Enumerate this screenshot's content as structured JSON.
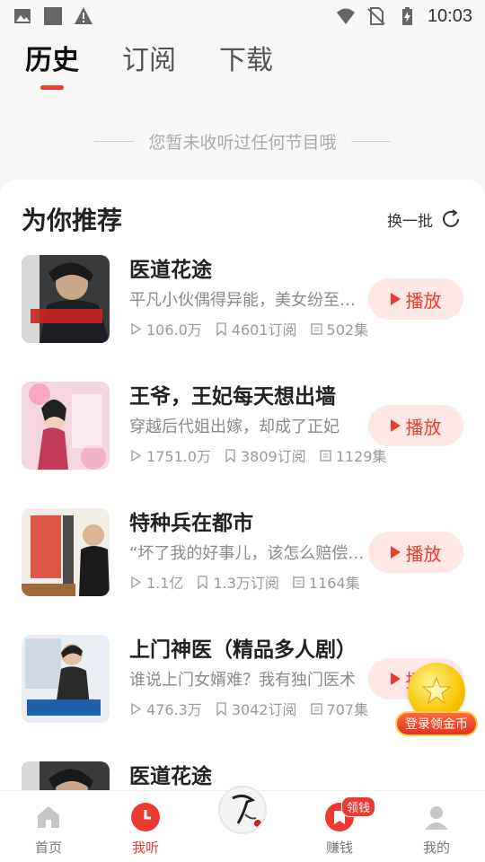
{
  "status_bar": {
    "time": "10:03",
    "icons_left": [
      "image-icon",
      "square-icon",
      "warning-icon"
    ],
    "icons_right": [
      "wifi-icon",
      "no-sim-icon",
      "battery-charging-icon"
    ]
  },
  "tabs": [
    {
      "label": "历史",
      "active": true
    },
    {
      "label": "订阅",
      "active": false
    },
    {
      "label": "下载",
      "active": false
    }
  ],
  "empty_text": "您暂未收听过任何节目哦",
  "recommend": {
    "title": "为你推荐",
    "refresh_label": "换一批",
    "play_label": "播放",
    "items": [
      {
        "title": "医道花途",
        "desc": "平凡小伙偶得异能，美女纷至沓来",
        "plays": "106.0万",
        "subs": "4601订阅",
        "eps": "502集"
      },
      {
        "title": "王爷，王妃每天想出墙",
        "desc": "穿越后代姐出嫁，却成了正妃",
        "plays": "1751.0万",
        "subs": "3809订阅",
        "eps": "1129集"
      },
      {
        "title": "特种兵在都市",
        "desc": "“坏了我的好事儿，该怎么赔偿我？”",
        "plays": "1.1亿",
        "subs": "1.3万订阅",
        "eps": "1164集"
      },
      {
        "title": "上门神医（精品多人剧）",
        "desc": "谁说上门女婿难？我有独门医术",
        "plays": "476.3万",
        "subs": "3042订阅",
        "eps": "707集"
      },
      {
        "title": "医道花途",
        "desc": "",
        "plays": "",
        "subs": "",
        "eps": ""
      }
    ]
  },
  "float_coin": {
    "label": "登录领金币"
  },
  "bottom_nav": [
    {
      "label": "首页",
      "icon": "home-icon",
      "active": false
    },
    {
      "label": "我听",
      "icon": "clock-icon",
      "active": true
    },
    {
      "label": "",
      "icon": "center-avatar-icon",
      "active": false
    },
    {
      "label": "赚钱",
      "icon": "wallet-icon",
      "active": false,
      "badge": "领钱"
    },
    {
      "label": "我的",
      "icon": "user-icon",
      "active": false
    }
  ],
  "colors": {
    "accent": "#ee3b2f",
    "play_bg": "#fde8e6",
    "coin": "#f7c400"
  }
}
